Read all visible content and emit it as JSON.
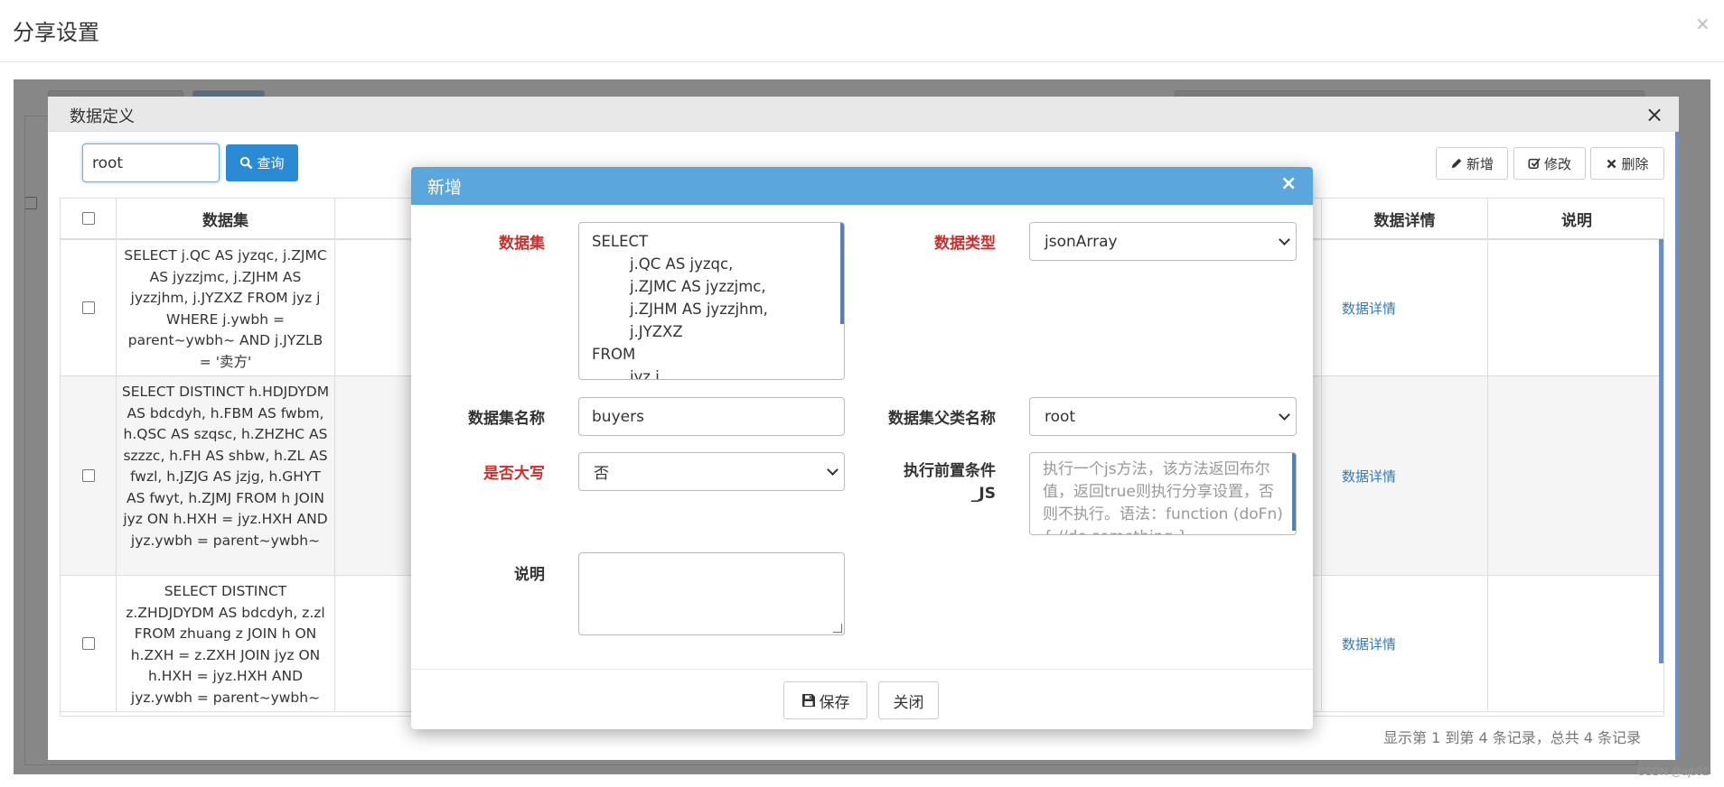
{
  "page": {
    "title": "分享设置",
    "close": "×",
    "watermark": "CSDN @ajb92"
  },
  "datadef_modal": {
    "title": "数据定义",
    "close": "×",
    "search_value": "root",
    "query_label": "查询",
    "toolbar": {
      "add": "新增",
      "edit": "修改",
      "delete": "删除"
    },
    "columns": [
      "数据集",
      "数据详情",
      "说明"
    ],
    "rows": [
      {
        "sql": "SELECT j.QC AS jyzqc, j.ZJMC AS jyzzjmc, j.ZJHM AS jyzzjhm, j.JYZXZ FROM jyz j WHERE j.ywbh = parent~ywbh~ AND j.JYZLB = '卖方'",
        "detail_link": "数据详情"
      },
      {
        "sql": "SELECT DISTINCT h.HDJDYDM AS bdcdyh, h.FBM AS fwbm, h.QSC AS szqsc, h.ZHZHC AS szzzc, h.FH AS shbw, h.ZL AS fwzl, h.JZJG AS jzjg, h.GHYT AS fwyt, h.ZJMJ FROM h JOIN jyz ON h.HXH = jyz.HXH AND jyz.ywbh = parent~ywbh~",
        "detail_link": "数据详情"
      },
      {
        "sql": "SELECT DISTINCT z.ZHDJDYDM AS bdcdyh, z.zl FROM zhuang z JOIN h ON h.ZXH = z.ZXH JOIN jyz ON h.HXH = jyz.HXH AND jyz.ywbh = parent~ywbh~",
        "detail_link": "数据详情"
      }
    ],
    "record_text": "显示第 1 到第 4 条记录，总共 4 条记录"
  },
  "add_modal": {
    "title": "新增",
    "close": "×",
    "labels": {
      "dataset": "数据集",
      "data_type": "数据类型",
      "dataset_name": "数据集名称",
      "parent_name": "数据集父类名称",
      "uppercase": "是否大写",
      "pre_condition_1": "执行前置条件",
      "pre_condition_2": "_JS",
      "description": "说明"
    },
    "sql_lines": [
      "SELECT",
      "        j.QC AS jyzqc,",
      "        j.ZJMC AS jyzzjmc,",
      "        j.ZJHM AS jyzzjhm,",
      "        j.JYZXZ",
      "FROM",
      "        jyz j"
    ],
    "data_type_value": "jsonArray",
    "dataset_name_value": "buyers",
    "parent_name_value": "root",
    "uppercase_value": "否",
    "js_placeholder": "执行一个js方法，该方法返回布尔值，返回true则执行分享设置，否则不执行。语法：function (doFn){ //do something }",
    "save_label": "保存",
    "close_label": "关闭"
  }
}
